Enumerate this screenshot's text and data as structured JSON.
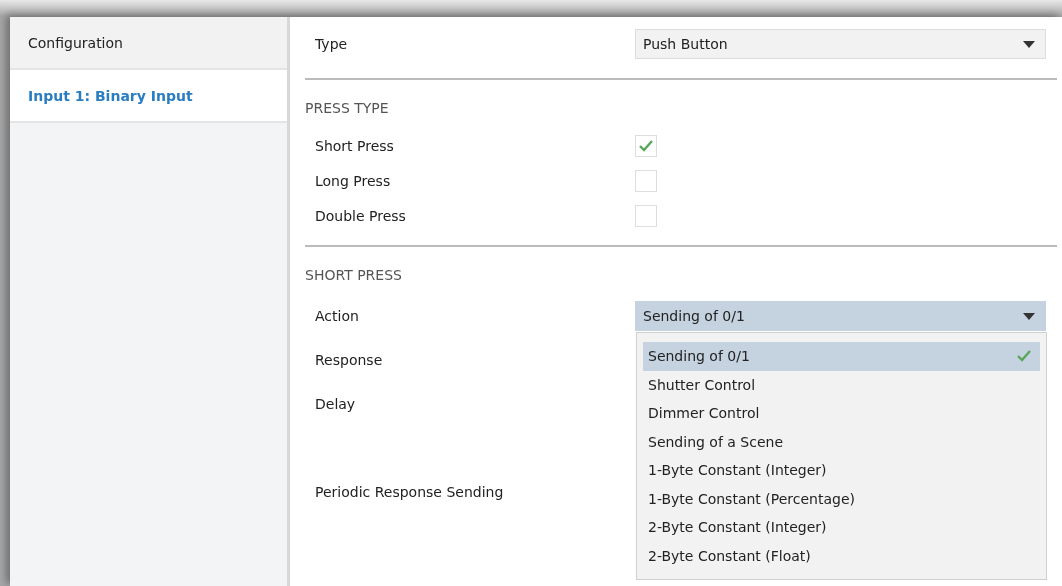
{
  "sidebar": {
    "items": [
      {
        "label": "Configuration",
        "selected": false
      },
      {
        "label": "Input 1: Binary Input",
        "selected": true
      }
    ]
  },
  "type_field": {
    "label": "Type",
    "value": "Push Button"
  },
  "press_type": {
    "heading": "PRESS TYPE",
    "options": [
      {
        "label": "Short Press",
        "checked": true
      },
      {
        "label": "Long Press",
        "checked": false
      },
      {
        "label": "Double Press",
        "checked": false
      }
    ]
  },
  "short_press": {
    "heading": "SHORT PRESS",
    "action": {
      "label": "Action",
      "value": "Sending of 0/1",
      "expanded": true
    },
    "fields": [
      "Response",
      "Delay",
      "Periodic Response Sending"
    ],
    "options": [
      {
        "label": "Sending of 0/1",
        "selected": true
      },
      {
        "label": "Shutter Control",
        "selected": false
      },
      {
        "label": "Dimmer Control",
        "selected": false
      },
      {
        "label": "Sending of a Scene",
        "selected": false
      },
      {
        "label": "1-Byte Constant (Integer)",
        "selected": false
      },
      {
        "label": "1-Byte Constant (Percentage)",
        "selected": false
      },
      {
        "label": "2-Byte Constant (Integer)",
        "selected": false
      },
      {
        "label": "2-Byte Constant (Float)",
        "selected": false
      }
    ]
  }
}
